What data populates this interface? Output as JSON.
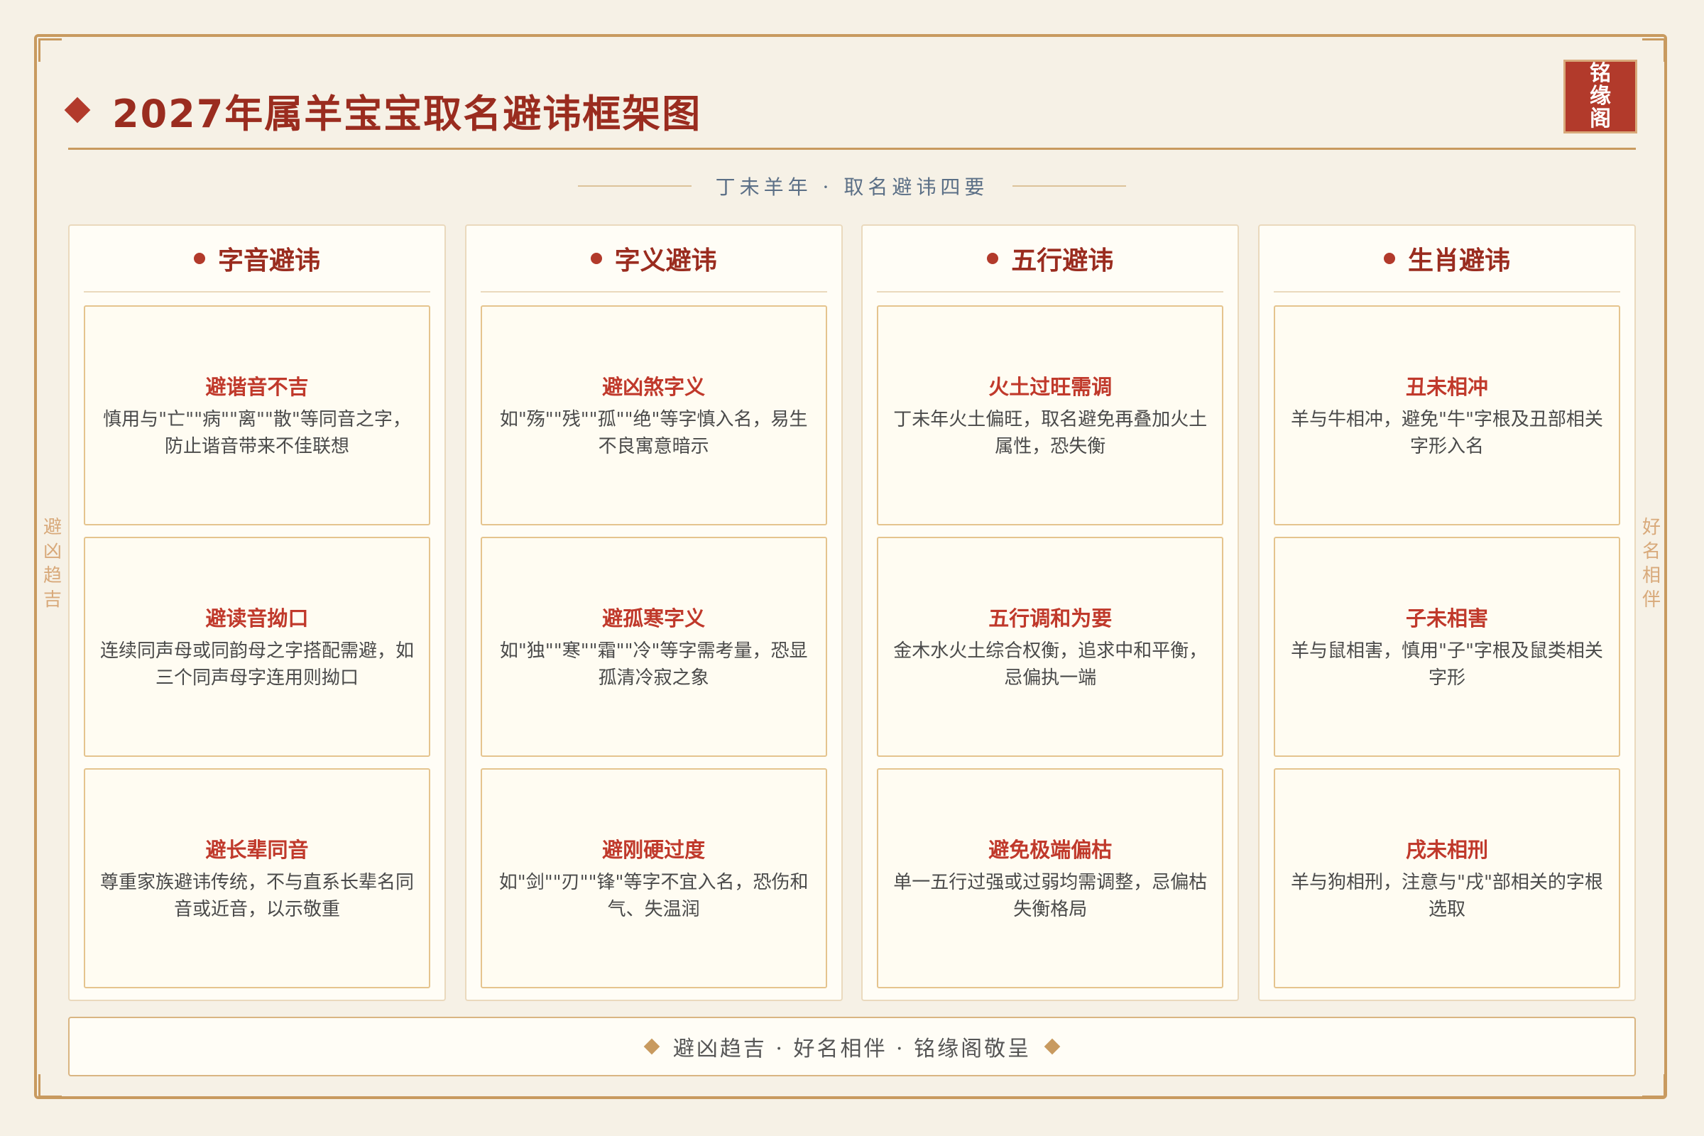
{
  "header": {
    "title": "2027年属羊宝宝取名避讳框架图",
    "seal_chars": [
      "铭",
      "缘",
      "阁"
    ],
    "subtitle": "丁未羊年 · 取名避讳四要"
  },
  "side_labels": {
    "left": [
      "避",
      "凶",
      "趋",
      "吉"
    ],
    "right": [
      "好",
      "名",
      "相",
      "伴"
    ]
  },
  "columns": [
    {
      "title": "字音避讳",
      "cards": [
        {
          "title": "避谐音不吉",
          "text": "慎用与\"亡\"\"病\"\"离\"\"散\"等同音之字，防止谐音带来不佳联想"
        },
        {
          "title": "避读音拗口",
          "text": "连续同声母或同韵母之字搭配需避，如三个同声母字连用则拗口"
        },
        {
          "title": "避长辈同音",
          "text": "尊重家族避讳传统，不与直系长辈名同音或近音，以示敬重"
        }
      ]
    },
    {
      "title": "字义避讳",
      "cards": [
        {
          "title": "避凶煞字义",
          "text": "如\"殇\"\"残\"\"孤\"\"绝\"等字慎入名，易生不良寓意暗示"
        },
        {
          "title": "避孤寒字义",
          "text": "如\"独\"\"寒\"\"霜\"\"冷\"等字需考量，恐显孤清冷寂之象"
        },
        {
          "title": "避刚硬过度",
          "text": "如\"剑\"\"刃\"\"锋\"等字不宜入名，恐伤和气、失温润"
        }
      ]
    },
    {
      "title": "五行避讳",
      "cards": [
        {
          "title": "火土过旺需调",
          "text": "丁未年火土偏旺，取名避免再叠加火土属性，恐失衡"
        },
        {
          "title": "五行调和为要",
          "text": "金木水火土综合权衡，追求中和平衡，忌偏执一端"
        },
        {
          "title": "避免极端偏枯",
          "text": "单一五行过强或过弱均需调整，忌偏枯失衡格局"
        }
      ]
    },
    {
      "title": "生肖避讳",
      "cards": [
        {
          "title": "丑未相冲",
          "text": "羊与牛相冲，避免\"牛\"字根及丑部相关字形入名"
        },
        {
          "title": "子未相害",
          "text": "羊与鼠相害，慎用\"子\"字根及鼠类相关字形"
        },
        {
          "title": "戌未相刑",
          "text": "羊与狗相刑，注意与\"戌\"部相关的字根选取"
        }
      ]
    }
  ],
  "footer": {
    "text": "避凶趋吉 · 好名相伴 · 铭缘阁敬呈"
  },
  "colors": {
    "accent_red": "#b23a2b",
    "title_red": "#9a2c1f",
    "gold": "#c89a5f",
    "background": "#f6f1e6"
  }
}
